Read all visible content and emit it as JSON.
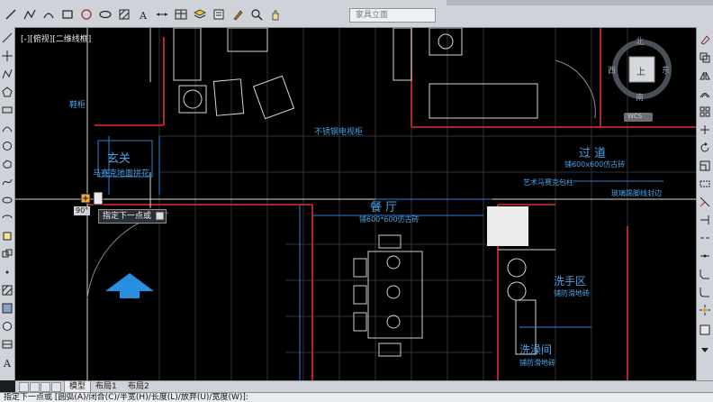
{
  "toolbar": {
    "tools": [
      "line-icon",
      "polyline-icon",
      "arc-icon",
      "rectangle-icon",
      "circle-icon",
      "ellipse-icon",
      "hatch-icon",
      "text-icon",
      "dimension-icon",
      "table-icon",
      "layer-icon",
      "properties-icon",
      "match-icon",
      "zoom-icon",
      "pan-icon"
    ],
    "layer_combo": "家具立面"
  },
  "viewport": {
    "label": "[-][俯视][二维线框]"
  },
  "compass": {
    "north": "北",
    "south": "南",
    "east": "东",
    "west": "西",
    "top": "上",
    "wcs": "WCS"
  },
  "rooms": {
    "shoe_cabinet": "鞋柜",
    "entry": "玄关",
    "entry_floor": "马赛克地面拼花",
    "tv_cabinet": "不锈钢电视柜",
    "aisle": "过 道",
    "aisle_floor": "铺600x600仿古砖",
    "mosaic": "艺术马赛克包柱",
    "glass_edge": "玻璃踢脚线封边",
    "dining": "餐 厅",
    "dining_floor": "铺600*600仿古砖",
    "wash": "洗手区",
    "wash_floor": "铺防滑地砖",
    "bath": "洗澡间",
    "bath_floor": "铺防滑地砖"
  },
  "cursor": {
    "tooltip": "指定下一点或",
    "angle": "90°"
  },
  "tabs": {
    "model": "模型",
    "layout1": "布局1",
    "layout2": "布局2"
  },
  "command": "指定下一点或 [圆弧(A)/闭合(C)/半宽(H)/长度(L)/放弃(U)/宽度(W)]:",
  "colors": {
    "background": "#000000",
    "wall_red": "#e0302a",
    "text_blue": "#4aa3e8",
    "grid": "#3a3f46",
    "white_line": "#d8d8d8"
  }
}
